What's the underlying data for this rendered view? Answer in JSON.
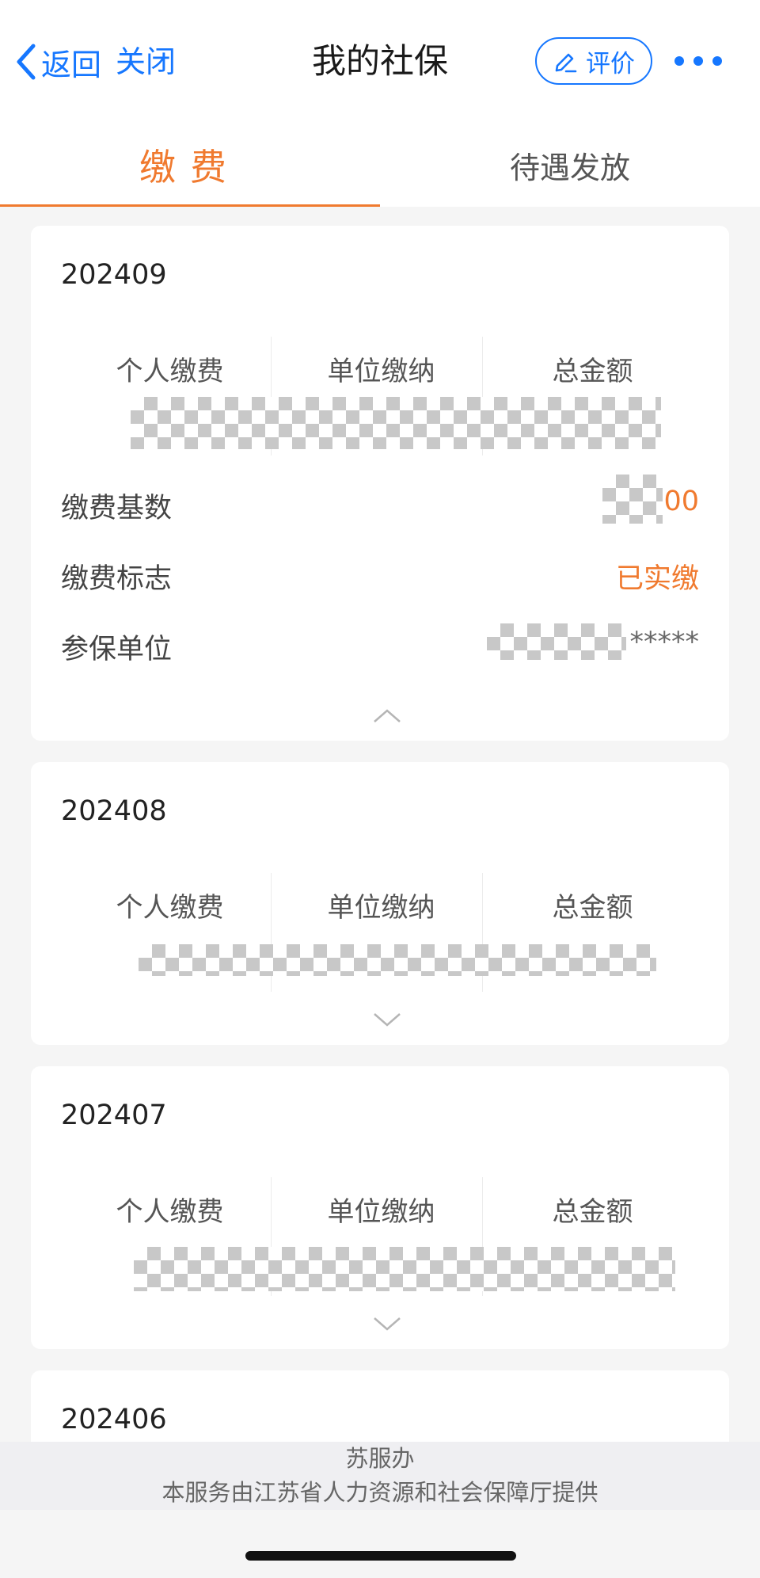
{
  "nav": {
    "back_label": "返回",
    "close_label": "关闭",
    "title": "我的社保",
    "rate_label": "评价",
    "accent_color": "#1677ff"
  },
  "tabs": [
    {
      "label": "缴费",
      "active": true
    },
    {
      "label": "待遇发放",
      "active": false
    }
  ],
  "columns": [
    "个人缴费",
    "单位缴纳",
    "总金额"
  ],
  "records": [
    {
      "month": "202409",
      "expanded": true,
      "details": [
        {
          "label": "缴费基数",
          "value": "00"
        },
        {
          "label": "缴费标志",
          "value": "已实缴"
        },
        {
          "label": "参保单位",
          "value": "*****"
        }
      ]
    },
    {
      "month": "202408",
      "expanded": false
    },
    {
      "month": "202407",
      "expanded": false
    },
    {
      "month": "202406",
      "expanded": false
    }
  ],
  "footer": {
    "title": "苏服办",
    "subtitle": "本服务由江苏省人力资源和社会保障厅提供"
  },
  "colors": {
    "highlight": "#f07a2f",
    "link": "#1677ff"
  }
}
